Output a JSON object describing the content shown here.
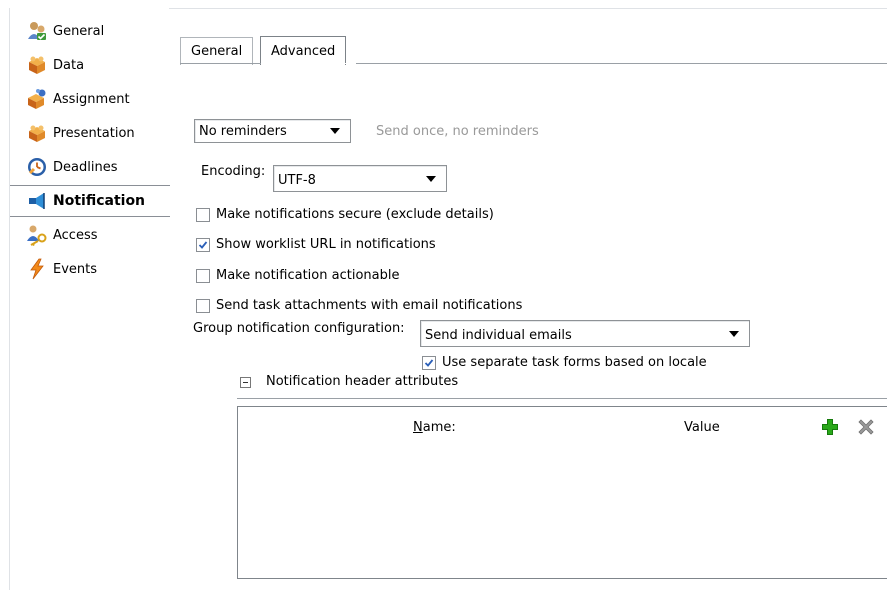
{
  "sidebar": {
    "items": [
      {
        "label": "General",
        "icon": "people-check-icon"
      },
      {
        "label": "Data",
        "icon": "data-box-icon"
      },
      {
        "label": "Assignment",
        "icon": "assignment-icon"
      },
      {
        "label": "Presentation",
        "icon": "presentation-icon"
      },
      {
        "label": "Deadlines",
        "icon": "clock-icon"
      },
      {
        "label": "Notification",
        "icon": "notification-megaphone-icon",
        "selected": true
      },
      {
        "label": "Access",
        "icon": "person-key-icon"
      },
      {
        "label": "Events",
        "icon": "lightning-icon"
      }
    ]
  },
  "tabs": {
    "general": "General",
    "advanced": "Advanced",
    "active": "Advanced"
  },
  "reminders": {
    "selected": "No reminders",
    "hint": "Send once, no reminders"
  },
  "encoding": {
    "label": "Encoding:",
    "selected": "UTF-8"
  },
  "options": {
    "secure": {
      "label": "Make notifications secure (exclude details)",
      "checked": false
    },
    "worklist_url": {
      "label": "Show worklist URL in notifications",
      "checked": true
    },
    "actionable": {
      "label": "Make notification actionable",
      "checked": false
    },
    "attachments": {
      "label": "Send task attachments with email notifications",
      "checked": false
    }
  },
  "group_config": {
    "label": "Group notification configuration:",
    "selected": "Send individual emails"
  },
  "locale_forms": {
    "label": "Use separate task forms based on locale",
    "checked": true
  },
  "header_attributes": {
    "section_label": "Notification header attributes",
    "columns": {
      "name": "Name:",
      "value": "Value"
    }
  },
  "colors": {
    "add": "#2aa81a",
    "remove": "#8a8a8a",
    "hint": "#999999",
    "check": "#2b5fb8"
  }
}
